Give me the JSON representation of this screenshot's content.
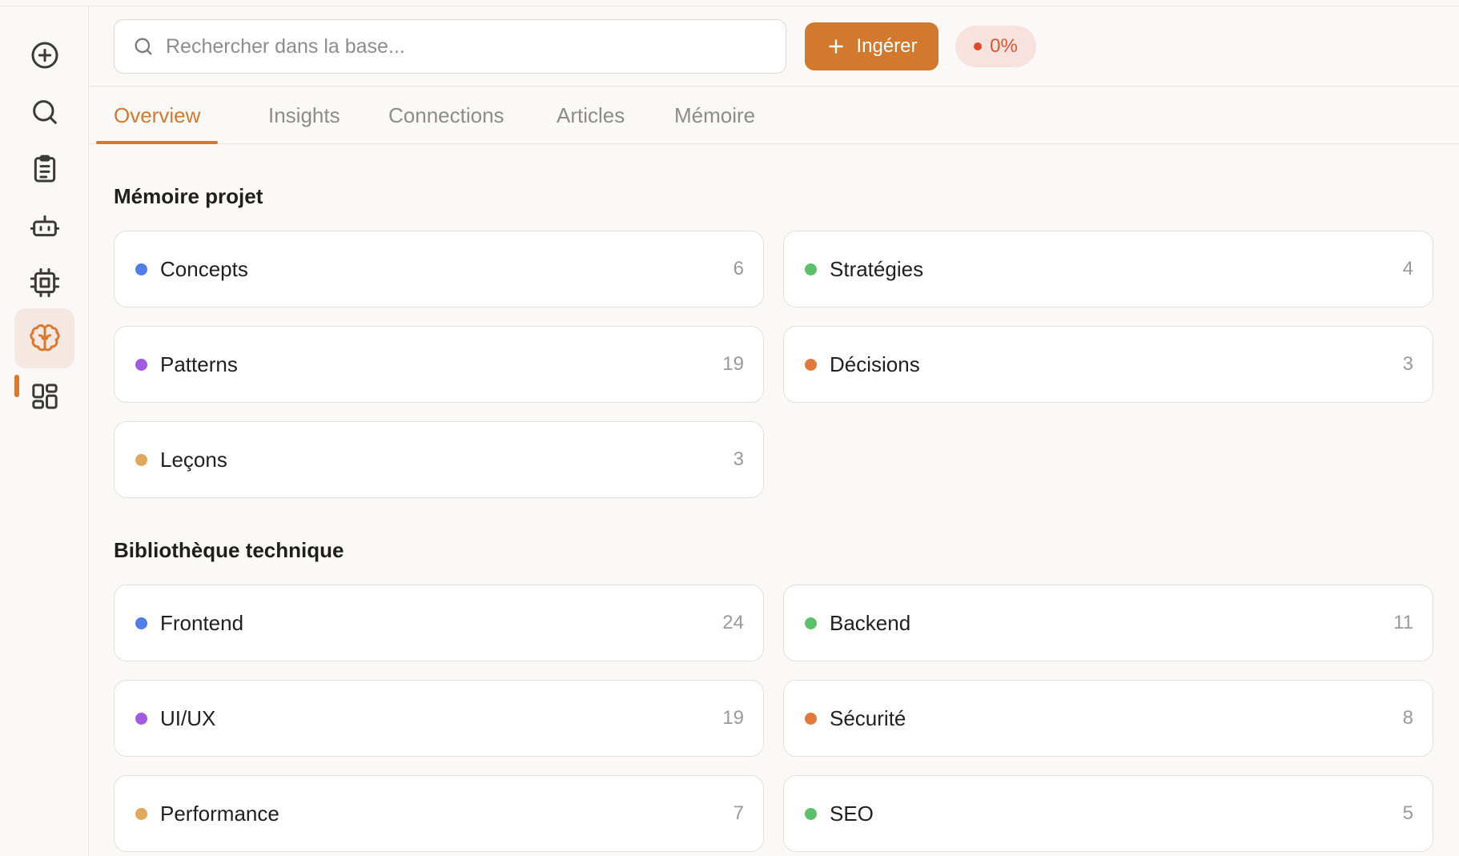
{
  "sidebar": {
    "items": [
      {
        "name": "plus-circle-icon"
      },
      {
        "name": "search-icon"
      },
      {
        "name": "clipboard-list-icon"
      },
      {
        "name": "robot-icon"
      },
      {
        "name": "cpu-chip-icon"
      },
      {
        "name": "brain-icon",
        "active": true
      },
      {
        "name": "dashboard-grid-icon"
      }
    ]
  },
  "header": {
    "search_placeholder": "Rechercher dans la base...",
    "ingest_label": "Ingérer",
    "progress_label": "0%",
    "progress_value": 0
  },
  "tabs": [
    {
      "label": "Overview",
      "active": true
    },
    {
      "label": "Insights"
    },
    {
      "label": "Connections"
    },
    {
      "label": "Articles"
    },
    {
      "label": "Mémoire"
    }
  ],
  "colors": {
    "accent": "#d17a2e",
    "blue": "#4f7fe6",
    "green": "#5cbf6a",
    "purple": "#a15ae0",
    "orange": "#e07a3c",
    "yellow": "#e0a85a"
  },
  "sections": [
    {
      "title": "Mémoire projet",
      "cards": [
        {
          "label": "Concepts",
          "count": "6",
          "color": "#4f7fe6"
        },
        {
          "label": "Stratégies",
          "count": "4",
          "color": "#5cbf6a"
        },
        {
          "label": "Patterns",
          "count": "19",
          "color": "#a15ae0"
        },
        {
          "label": "Décisions",
          "count": "3",
          "color": "#e07a3c"
        },
        {
          "label": "Leçons",
          "count": "3",
          "color": "#e0a85a"
        }
      ]
    },
    {
      "title": "Bibliothèque technique",
      "cards": [
        {
          "label": "Frontend",
          "count": "24",
          "color": "#4f7fe6"
        },
        {
          "label": "Backend",
          "count": "11",
          "color": "#5cbf6a"
        },
        {
          "label": "UI/UX",
          "count": "19",
          "color": "#a15ae0"
        },
        {
          "label": "Sécurité",
          "count": "8",
          "color": "#e07a3c"
        },
        {
          "label": "Performance",
          "count": "7",
          "color": "#e0a85a"
        },
        {
          "label": "SEO",
          "count": "5",
          "color": "#5cbf6a"
        }
      ]
    }
  ]
}
